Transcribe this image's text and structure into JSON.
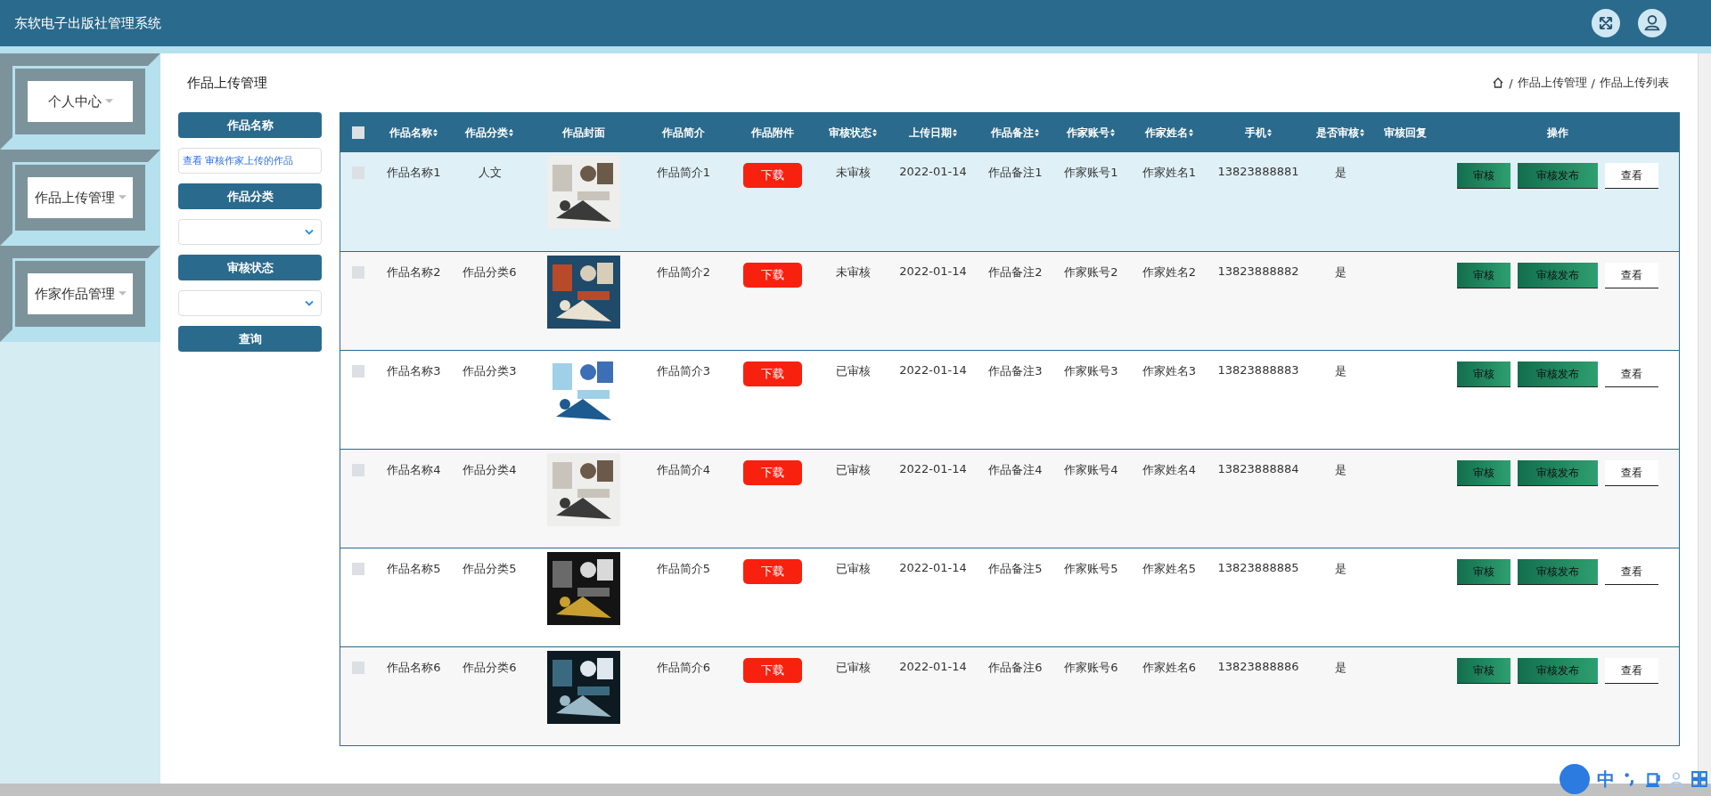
{
  "header": {
    "title": "东软电子出版社管理系统"
  },
  "sidebar": {
    "items": [
      {
        "label": "个人中心"
      },
      {
        "label": "作品上传管理"
      },
      {
        "label": "作家作品管理"
      }
    ]
  },
  "page_title": "作品上传管理",
  "breadcrumb": {
    "items": [
      "作品上传管理",
      "作品上传列表"
    ],
    "separator": "/"
  },
  "filters": [
    {
      "kind": "text",
      "label": "作品名称",
      "value": "查看 审核作家上传的作品"
    },
    {
      "kind": "select",
      "label": "作品分类"
    },
    {
      "kind": "select",
      "label": "审核状态"
    }
  ],
  "search_button": "查询",
  "table": {
    "select_all": {
      "checked": false
    },
    "columns": [
      {
        "label": "作品名称",
        "sortable": true
      },
      {
        "label": "作品分类",
        "sortable": true
      },
      {
        "label": "作品封面",
        "sortable": false
      },
      {
        "label": "作品简介",
        "sortable": false
      },
      {
        "label": "作品附件",
        "sortable": false
      },
      {
        "label": "审核状态",
        "sortable": true
      },
      {
        "label": "上传日期",
        "sortable": true
      },
      {
        "label": "作品备注",
        "sortable": true
      },
      {
        "label": "作家账号",
        "sortable": true
      },
      {
        "label": "作家姓名",
        "sortable": true
      },
      {
        "label": "手机",
        "sortable": true
      },
      {
        "label": "是否审核",
        "sortable": true
      },
      {
        "label": "审核回复",
        "sortable": false
      },
      {
        "label": "操作",
        "sortable": false
      }
    ],
    "rows": [
      {
        "checked": false,
        "hovered": true,
        "name": "作品名称1",
        "category": "人文",
        "intro": "作品简介1",
        "download": "下载",
        "status": "未审核",
        "date": "2022-01-14",
        "note": "作品备注1",
        "account": "作家账号1",
        "author": "作家姓名1",
        "phone": "13823888881",
        "reviewed": "是",
        "actions": [
          "审核",
          "审核发布",
          "查看"
        ]
      },
      {
        "checked": false,
        "hovered": false,
        "name": "作品名称2",
        "category": "作品分类6",
        "intro": "作品简介2",
        "download": "下载",
        "status": "未审核",
        "date": "2022-01-14",
        "note": "作品备注2",
        "account": "作家账号2",
        "author": "作家姓名2",
        "phone": "13823888882",
        "reviewed": "是",
        "actions": [
          "审核",
          "审核发布",
          "查看"
        ]
      },
      {
        "checked": false,
        "hovered": false,
        "name": "作品名称3",
        "category": "作品分类3",
        "intro": "作品简介3",
        "download": "下载",
        "status": "已审核",
        "date": "2022-01-14",
        "note": "作品备注3",
        "account": "作家账号3",
        "author": "作家姓名3",
        "phone": "13823888883",
        "reviewed": "是",
        "actions": [
          "审核",
          "审核发布",
          "查看"
        ]
      },
      {
        "checked": false,
        "hovered": false,
        "name": "作品名称4",
        "category": "作品分类4",
        "intro": "作品简介4",
        "download": "下载",
        "status": "已审核",
        "date": "2022-01-14",
        "note": "作品备注4",
        "account": "作家账号4",
        "author": "作家姓名4",
        "phone": "13823888884",
        "reviewed": "是",
        "actions": [
          "审核",
          "审核发布",
          "查看"
        ]
      },
      {
        "checked": false,
        "hovered": false,
        "name": "作品名称5",
        "category": "作品分类5",
        "intro": "作品简介5",
        "download": "下载",
        "status": "已审核",
        "date": "2022-01-14",
        "note": "作品备注5",
        "account": "作家账号5",
        "author": "作家姓名5",
        "phone": "13823888885",
        "reviewed": "是",
        "actions": [
          "审核",
          "审核发布",
          "查看"
        ]
      },
      {
        "checked": false,
        "hovered": false,
        "name": "作品名称6",
        "category": "作品分类6",
        "intro": "作品简介6",
        "download": "下载",
        "status": "已审核",
        "date": "2022-01-14",
        "note": "作品备注6",
        "account": "作家账号6",
        "author": "作家姓名6",
        "phone": "13823888886",
        "reviewed": "是",
        "actions": [
          "审核",
          "审核发布",
          "查看"
        ]
      }
    ]
  },
  "ime": {
    "mode": "中"
  }
}
